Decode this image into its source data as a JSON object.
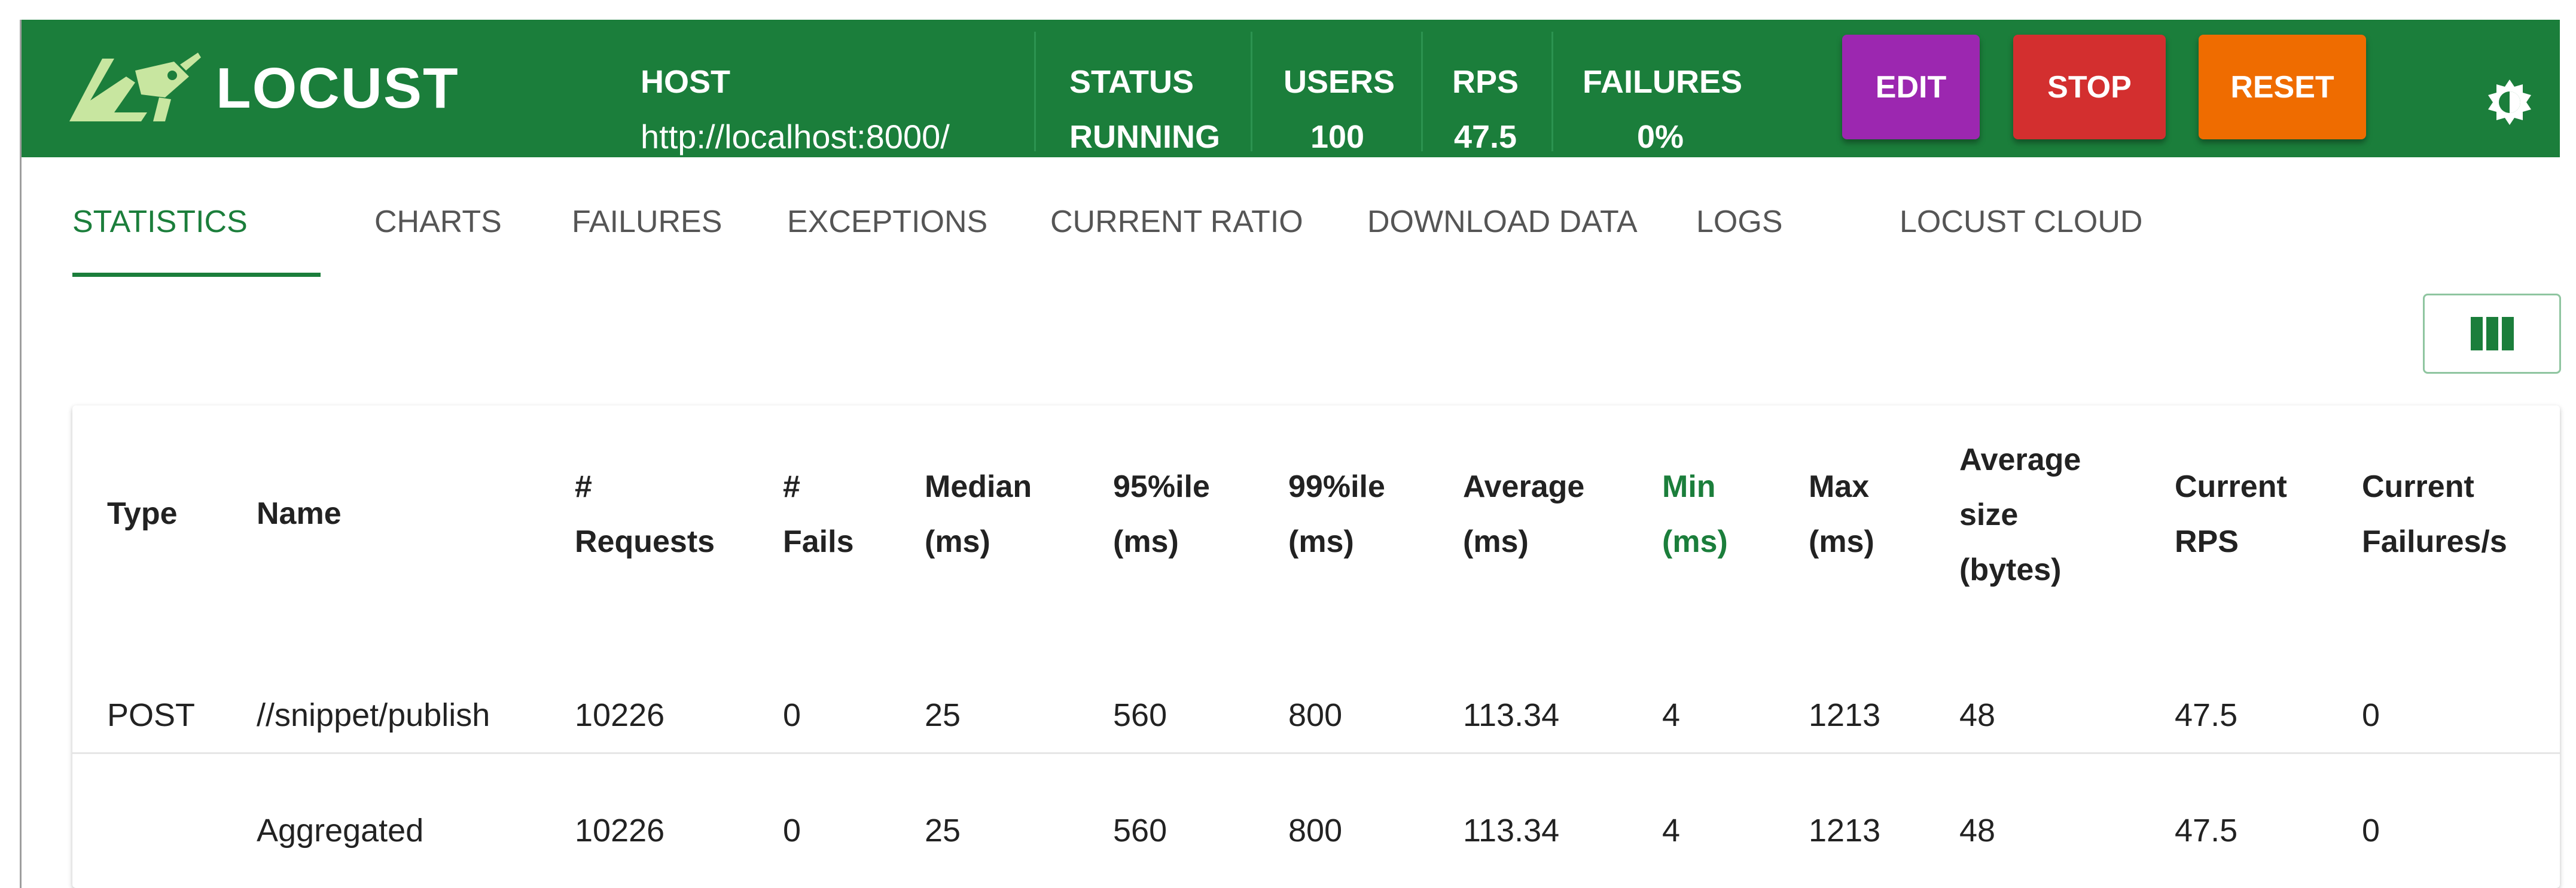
{
  "app": {
    "name": "LOCUST"
  },
  "header": {
    "host_label": "HOST",
    "host_value": "http://localhost:8000/",
    "status_label": "STATUS",
    "status_value": "RUNNING",
    "users_label": "USERS",
    "users_value": "100",
    "rps_label": "RPS",
    "rps_value": "47.5",
    "failures_label": "FAILURES",
    "failures_value": "0%"
  },
  "buttons": {
    "edit": "EDIT",
    "stop": "STOP",
    "reset": "RESET"
  },
  "colors": {
    "brand": "#1b7e3b",
    "edit": "#9c27b0",
    "stop": "#d32f2f",
    "reset": "#ef6c00"
  },
  "tabs": [
    {
      "label": "STATISTICS",
      "active": true
    },
    {
      "label": "CHARTS"
    },
    {
      "label": "FAILURES"
    },
    {
      "label": "EXCEPTIONS"
    },
    {
      "label": "CURRENT RATIO"
    },
    {
      "label": "DOWNLOAD DATA"
    },
    {
      "label": "LOGS"
    },
    {
      "label": "LOCUST CLOUD"
    }
  ],
  "table": {
    "headers": [
      [
        "Type"
      ],
      [
        "Name"
      ],
      [
        "#",
        "Requests"
      ],
      [
        "#",
        "Fails"
      ],
      [
        "Median",
        "(ms)"
      ],
      [
        "95%ile",
        "(ms)"
      ],
      [
        "99%ile",
        "(ms)"
      ],
      [
        "Average",
        "(ms)"
      ],
      [
        "Min",
        "(ms)"
      ],
      [
        "Max",
        "(ms)"
      ],
      [
        "Average",
        "size",
        "(bytes)"
      ],
      [
        "Current",
        "RPS"
      ],
      [
        "Current",
        "Failures/s"
      ]
    ],
    "rows": [
      [
        "POST",
        "//snippet/publish",
        "10226",
        "0",
        "25",
        "560",
        "800",
        "113.34",
        "4",
        "1213",
        "48",
        "47.5",
        "0"
      ],
      [
        "",
        "Aggregated",
        "10226",
        "0",
        "25",
        "560",
        "800",
        "113.34",
        "4",
        "1213",
        "48",
        "47.5",
        "0"
      ]
    ]
  }
}
